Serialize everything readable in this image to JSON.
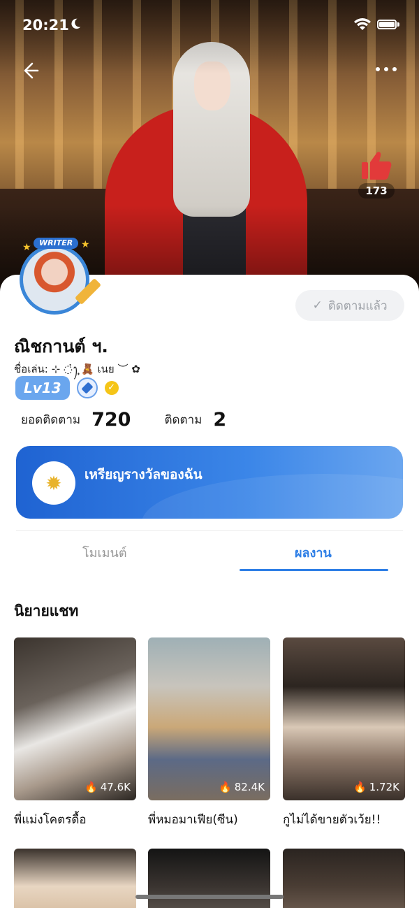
{
  "status_bar": {
    "time": "20:21"
  },
  "banner": {
    "like_count": "173"
  },
  "profile": {
    "avatar_badge": "WRITER",
    "follow_button_label": "ติดตามแล้ว",
    "name": "ณิชกานต์ ฯ.",
    "nickname": "ชื่อเล่น: ⊹ ◌҆ꫂ ̟🧸 เนย ︶ ✿",
    "level": "Lv13"
  },
  "stats": {
    "followers_label": "ยอดติดตาม",
    "followers_value": "720",
    "following_label": "ติดตาม",
    "following_value": "2"
  },
  "reward": {
    "label": "เหรียญรางวัลของฉัน"
  },
  "tabs": [
    {
      "label": "โมเมนต์",
      "active": false
    },
    {
      "label": "ผลงาน",
      "active": true
    }
  ],
  "section": {
    "title": "นิยายแชท"
  },
  "stories": [
    {
      "title": "พี่แม่งโคตรดื้อ",
      "views": "47.6K"
    },
    {
      "title": "พี่หมอมาเฟีย(ซีน)",
      "views": "82.4K"
    },
    {
      "title": "กูไม่ได้ขายตัวเว้ย!!",
      "views": "1.72K"
    },
    {
      "title": "",
      "views": ""
    },
    {
      "title": "",
      "views": ""
    },
    {
      "title": "",
      "views": ""
    }
  ],
  "colors": {
    "accent": "#2f7fe6",
    "like": "#e23a3a",
    "level_badge": "#6aa6ee"
  }
}
